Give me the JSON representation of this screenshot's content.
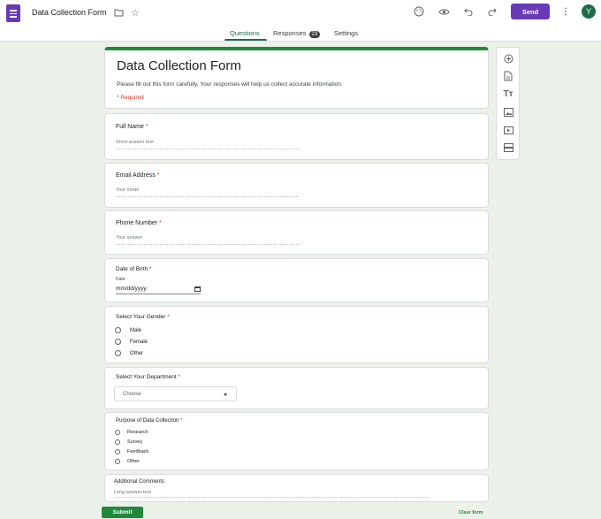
{
  "header": {
    "doc_title": "Data Collection Form",
    "send_label": "Send",
    "avatar_initial": "Y",
    "icons": [
      "forms-app-icon",
      "folder-icon",
      "star-icon",
      "palette-icon",
      "preview-eye-icon",
      "undo-icon",
      "redo-icon",
      "more-vert-icon"
    ]
  },
  "tabs": {
    "questions": "Questions",
    "responses": "Responses",
    "responses_count": "23",
    "settings": "Settings"
  },
  "form": {
    "title": "Data Collection Form",
    "description": "Please fill out this form carefully. Your responses will help us collect accurate information.",
    "required_note": "* Required"
  },
  "questions": {
    "full_name": {
      "label": "Full Name",
      "required": "*",
      "placeholder": "Short answer text"
    },
    "email": {
      "label": "Email Address",
      "required": "*",
      "placeholder": "Your email"
    },
    "phone": {
      "label": "Phone Number",
      "required": "*",
      "placeholder": "Your answer"
    },
    "dob": {
      "label": "Date of Birth",
      "required": "*",
      "sub_label": "Date",
      "value": "mm/dd/yyyy"
    },
    "gender": {
      "label": "Select Your Gender",
      "required": "*",
      "options": [
        "Male",
        "Female",
        "Other"
      ]
    },
    "department": {
      "label": "Select Your Department",
      "required": "*",
      "selected": "Choose"
    },
    "purpose": {
      "label": "Purpose of Data Collection",
      "required": "*",
      "options": [
        "Research",
        "Survey",
        "Feedback",
        "Other"
      ]
    },
    "comments": {
      "label": "Additional Comments",
      "placeholder": "Long answer text"
    }
  },
  "side_toolbar": [
    "add-question-icon",
    "import-questions-icon",
    "add-title-icon",
    "add-image-icon",
    "add-video-icon",
    "add-section-icon"
  ],
  "footer": {
    "submit_label": "Submit",
    "clear_label": "Clear form"
  },
  "colors": {
    "brand_purple": "#673ab7",
    "accent_green": "#1e8a3a",
    "required_red": "#d93025",
    "background": "#ecf1e9"
  }
}
